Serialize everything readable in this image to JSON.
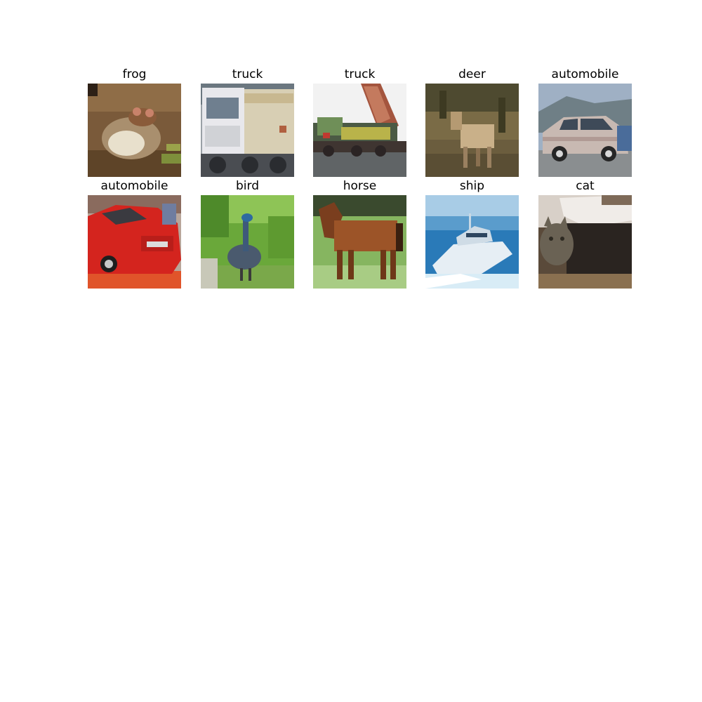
{
  "figure": {
    "background": "#ffffff",
    "panels": [
      {
        "title": "frog"
      },
      {
        "title": "truck"
      },
      {
        "title": "truck"
      },
      {
        "title": "deer"
      },
      {
        "title": "automobile"
      },
      {
        "title": "automobile"
      },
      {
        "title": "bird"
      },
      {
        "title": "horse"
      },
      {
        "title": "ship"
      },
      {
        "title": "cat"
      }
    ]
  }
}
